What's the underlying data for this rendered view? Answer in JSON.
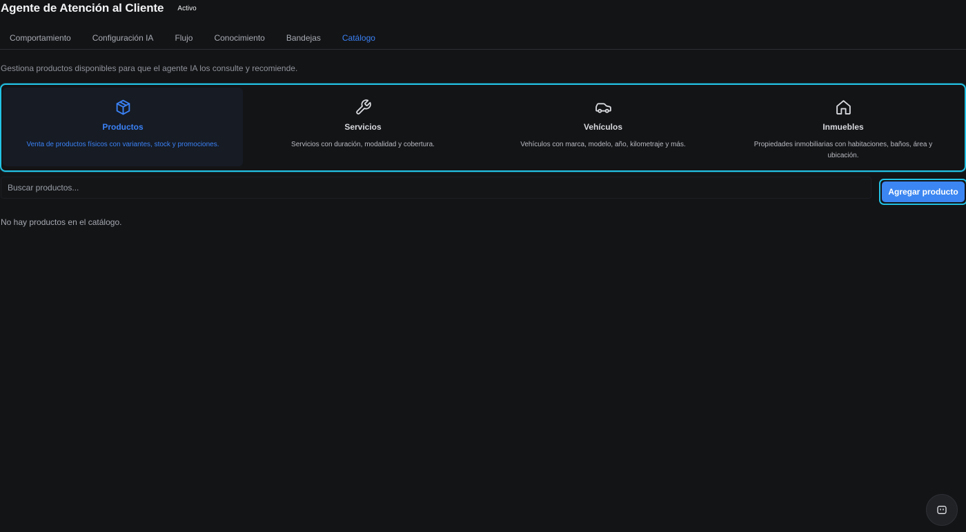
{
  "header": {
    "title": "Agente de Atención al Cliente",
    "status": "Activo"
  },
  "tabs": [
    {
      "label": "Comportamiento",
      "active": false
    },
    {
      "label": "Configuración IA",
      "active": false
    },
    {
      "label": "Flujo",
      "active": false
    },
    {
      "label": "Conocimiento",
      "active": false
    },
    {
      "label": "Bandejas",
      "active": false
    },
    {
      "label": "Catálogo",
      "active": true
    }
  ],
  "catalog": {
    "description": "Gestiona productos disponibles para que el agente IA los consulte y recomiende.",
    "categories": [
      {
        "name": "Productos",
        "icon": "box-icon",
        "description": "Venta de productos físicos con variantes, stock y promociones.",
        "selected": true
      },
      {
        "name": "Servicios",
        "icon": "wrench-icon",
        "description": "Servicios con duración, modalidad y cobertura.",
        "selected": false
      },
      {
        "name": "Vehículos",
        "icon": "car-icon",
        "description": "Vehículos con marca, modelo, año, kilometraje y más.",
        "selected": false
      },
      {
        "name": "Inmuebles",
        "icon": "house-icon",
        "description": "Propiedades inmobiliarias con habitaciones, baños, área y ubicación.",
        "selected": false
      }
    ],
    "search_placeholder": "Buscar productos...",
    "search_value": "",
    "add_button_label": "Agregar producto",
    "empty_message": "No hay productos en el catálogo."
  },
  "chat_fab": {
    "icon": "chat-bot-icon"
  },
  "colors": {
    "accent": "#3b82f6",
    "focus_ring": "#22c3e6",
    "background": "#131416"
  }
}
